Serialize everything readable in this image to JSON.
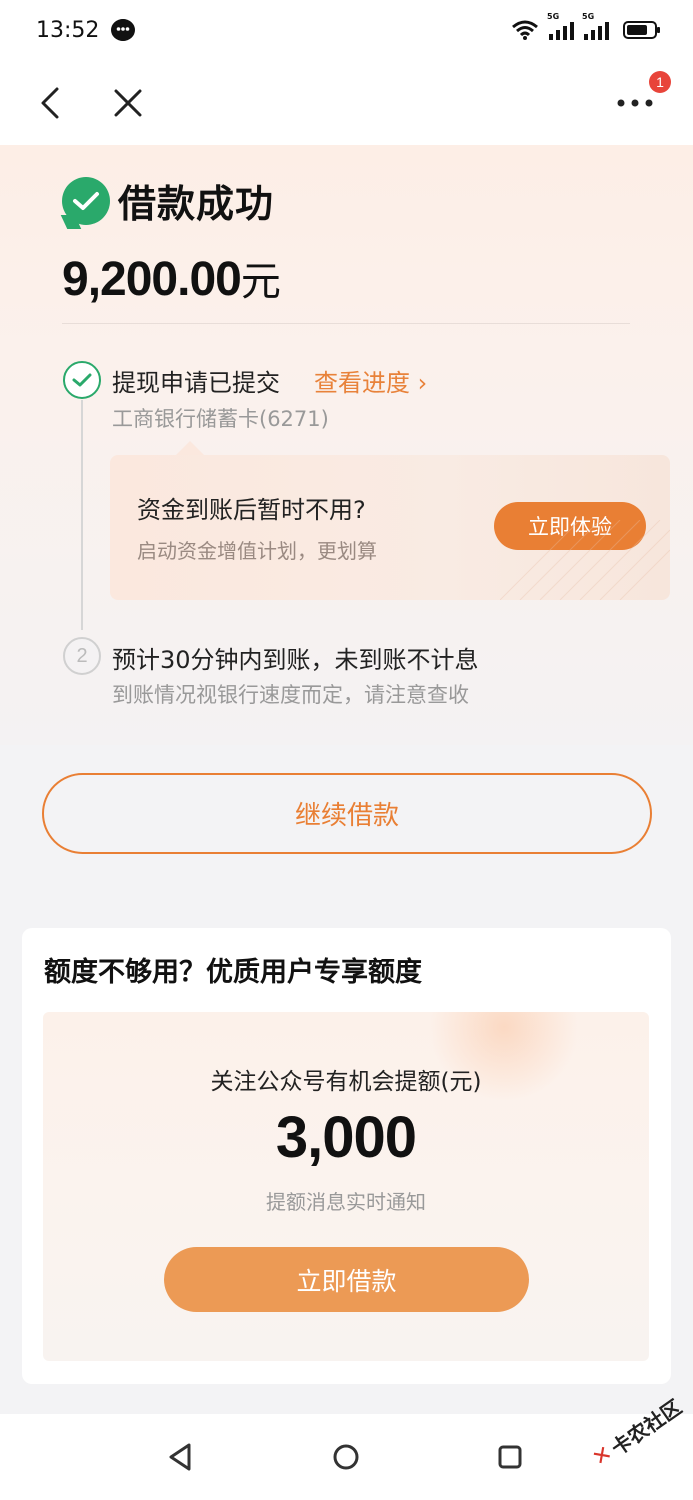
{
  "status_bar": {
    "time": "13:52",
    "signal1_tag": "5G",
    "signal2_tag": "5G"
  },
  "nav": {
    "badge_count": "1"
  },
  "hero": {
    "title": "借款成功",
    "amount": "9,200.00",
    "amount_unit": "元",
    "success_color": "#2aa96b"
  },
  "steps": {
    "step1_title": "提现申请已提交",
    "step1_link": "查看进度 ›",
    "step1_sub": "工商银行储蓄卡(6271)",
    "step2_number": "2",
    "step2_title": "预计30分钟内到账，未到账不计息",
    "step2_sub": "到账情况视银行速度而定，请注意查收"
  },
  "promo": {
    "title": "资金到账后暂时不用?",
    "subtitle": "启动资金增值计划，更划算",
    "button": "立即体验"
  },
  "continue_button": "继续借款",
  "quota_card": {
    "title": "额度不够用？优质用户专享额度",
    "inner_title": "关注公众号有机会提额(元)",
    "amount": "3,000",
    "subtitle": "提额消息实时通知",
    "button": "立即借款"
  },
  "watermark": {
    "mark": "✕",
    "text": "卡农社区"
  },
  "colors": {
    "accent": "#e97f34",
    "accent_light": "#ec9a55",
    "success": "#2aa96b",
    "badge": "#e8443a"
  }
}
